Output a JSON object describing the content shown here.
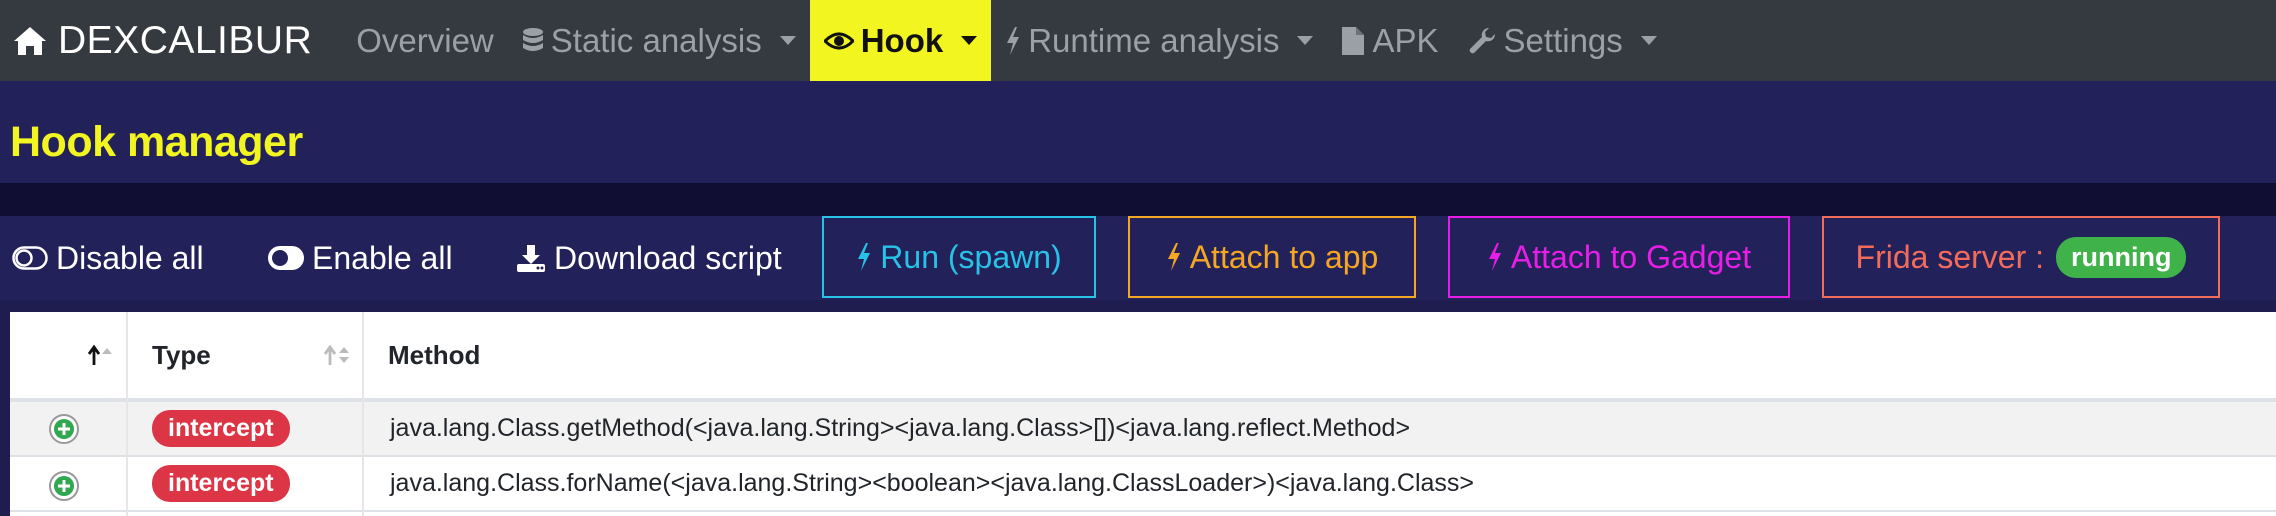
{
  "navbar": {
    "brand": "DEXCALIBUR",
    "items": [
      {
        "label": "Overview",
        "icon": "none",
        "has_caret": false,
        "active": false
      },
      {
        "label": "Static analysis",
        "icon": "database-icon",
        "has_caret": true,
        "active": false
      },
      {
        "label": "Hook",
        "icon": "eye-icon",
        "has_caret": true,
        "active": true
      },
      {
        "label": "Runtime analysis",
        "icon": "bolt-icon",
        "has_caret": true,
        "active": false
      },
      {
        "label": "APK",
        "icon": "file-icon",
        "has_caret": false,
        "active": false
      },
      {
        "label": "Settings",
        "icon": "wrench-icon",
        "has_caret": true,
        "active": false
      }
    ]
  },
  "page": {
    "title": "Hook manager"
  },
  "toolbar": {
    "disable_all": "Disable all",
    "enable_all": "Enable all",
    "download_script": "Download script",
    "run_spawn": "Run (spawn)",
    "attach_app": "Attach to app",
    "attach_gadget": "Attach to Gadget",
    "frida_label": "Frida server :",
    "frida_status": "running"
  },
  "colors": {
    "accent_yellow": "#f2f51f",
    "run_spawn": "#27c3e6",
    "attach_app": "#f5a623",
    "attach_gadget": "#e81ee8",
    "frida": "#f26b5b",
    "running_badge": "#3fb24a",
    "intercept_badge": "#dc3545"
  },
  "table": {
    "columns": [
      "",
      "Type",
      "Method"
    ],
    "rows": [
      {
        "type": "intercept",
        "method": "java.lang.Class.getMethod(<java.lang.String><java.lang.Class>[])<java.lang.reflect.Method>"
      },
      {
        "type": "intercept",
        "method": "java.lang.Class.forName(<java.lang.String><boolean><java.lang.ClassLoader>)<java.lang.Class>"
      }
    ]
  }
}
